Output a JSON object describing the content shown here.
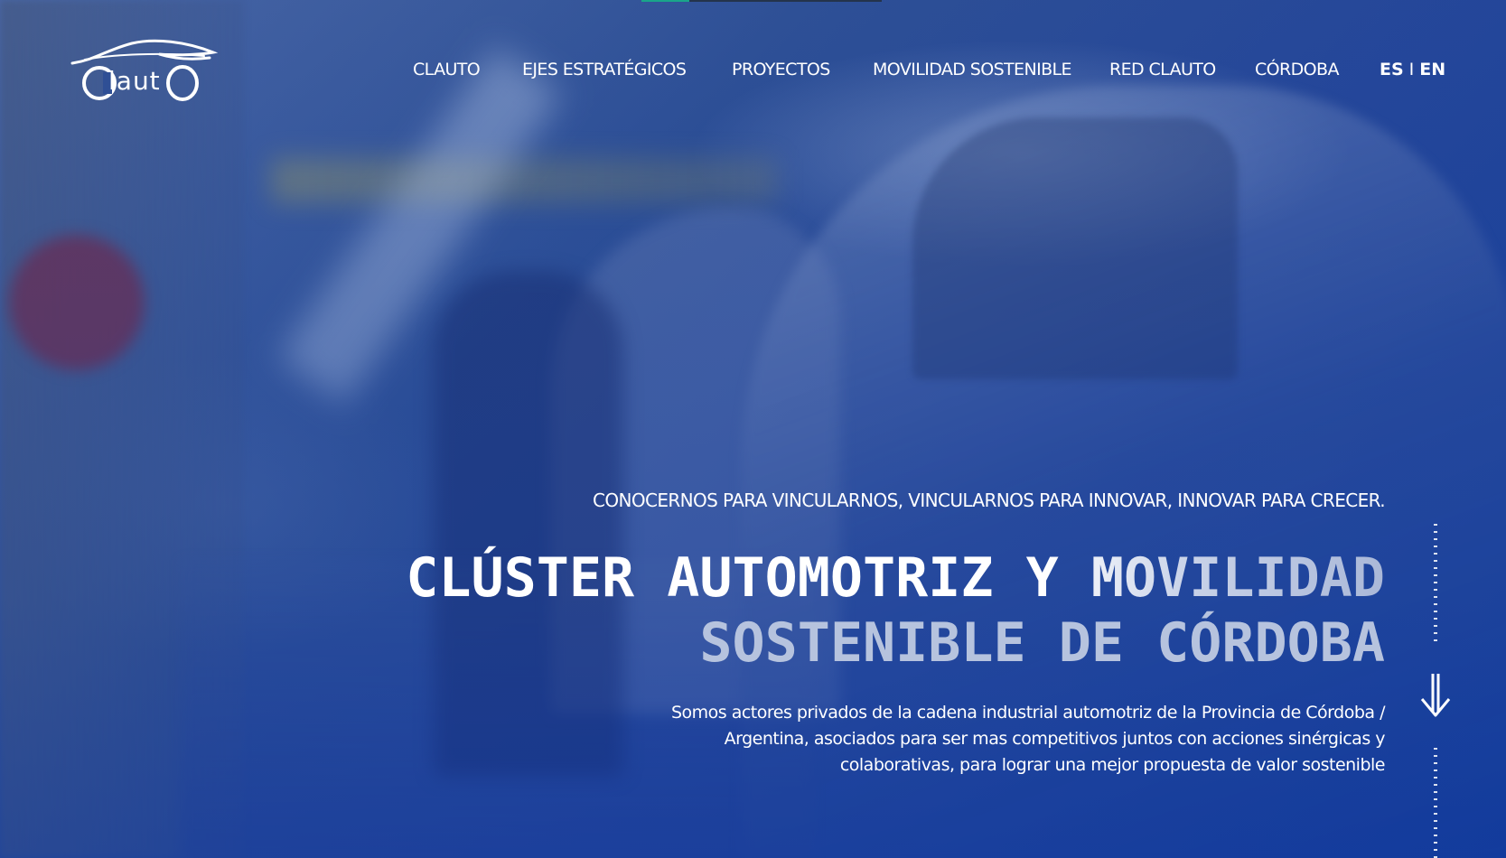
{
  "brand": {
    "logo_text": "ClautO"
  },
  "nav": {
    "items": [
      {
        "label": "CLAUTO"
      },
      {
        "label": "EJES ESTRATÉGICOS"
      },
      {
        "label": "PROYECTOS"
      },
      {
        "label": "MOVILIDAD SOSTENIBLE"
      },
      {
        "label": "RED CLAUTO"
      },
      {
        "label": "CÓRDOBA"
      }
    ],
    "lang": {
      "es": "ES",
      "separator": "I",
      "en": "EN"
    }
  },
  "hero": {
    "tagline": "CONOCERNOS PARA VINCULARNOS, VINCULARNOS PARA INNOVAR, INNOVAR PARA CRECER.",
    "title_line1": "CLÚSTER AUTOMOTRIZ Y MOVILIDAD",
    "title_line2": "SOSTENIBLE DE CÓRDOBA",
    "description": "Somos actores privados de la cadena industrial automotriz de la Provincia de Córdoba / Argentina, asociados para ser mas competitivos juntos con acciones sinérgicas y colaborativas, para lograr una mejor propuesta de valor sostenible"
  },
  "icons": {
    "scroll": "arrow-down-icon",
    "logo": "car-outline-icon"
  },
  "colors": {
    "overlay_blue": "#1b3f8a",
    "text": "#ffffff",
    "headline_muted": "#b6c3de",
    "accent_teal": "#1aa58a"
  }
}
